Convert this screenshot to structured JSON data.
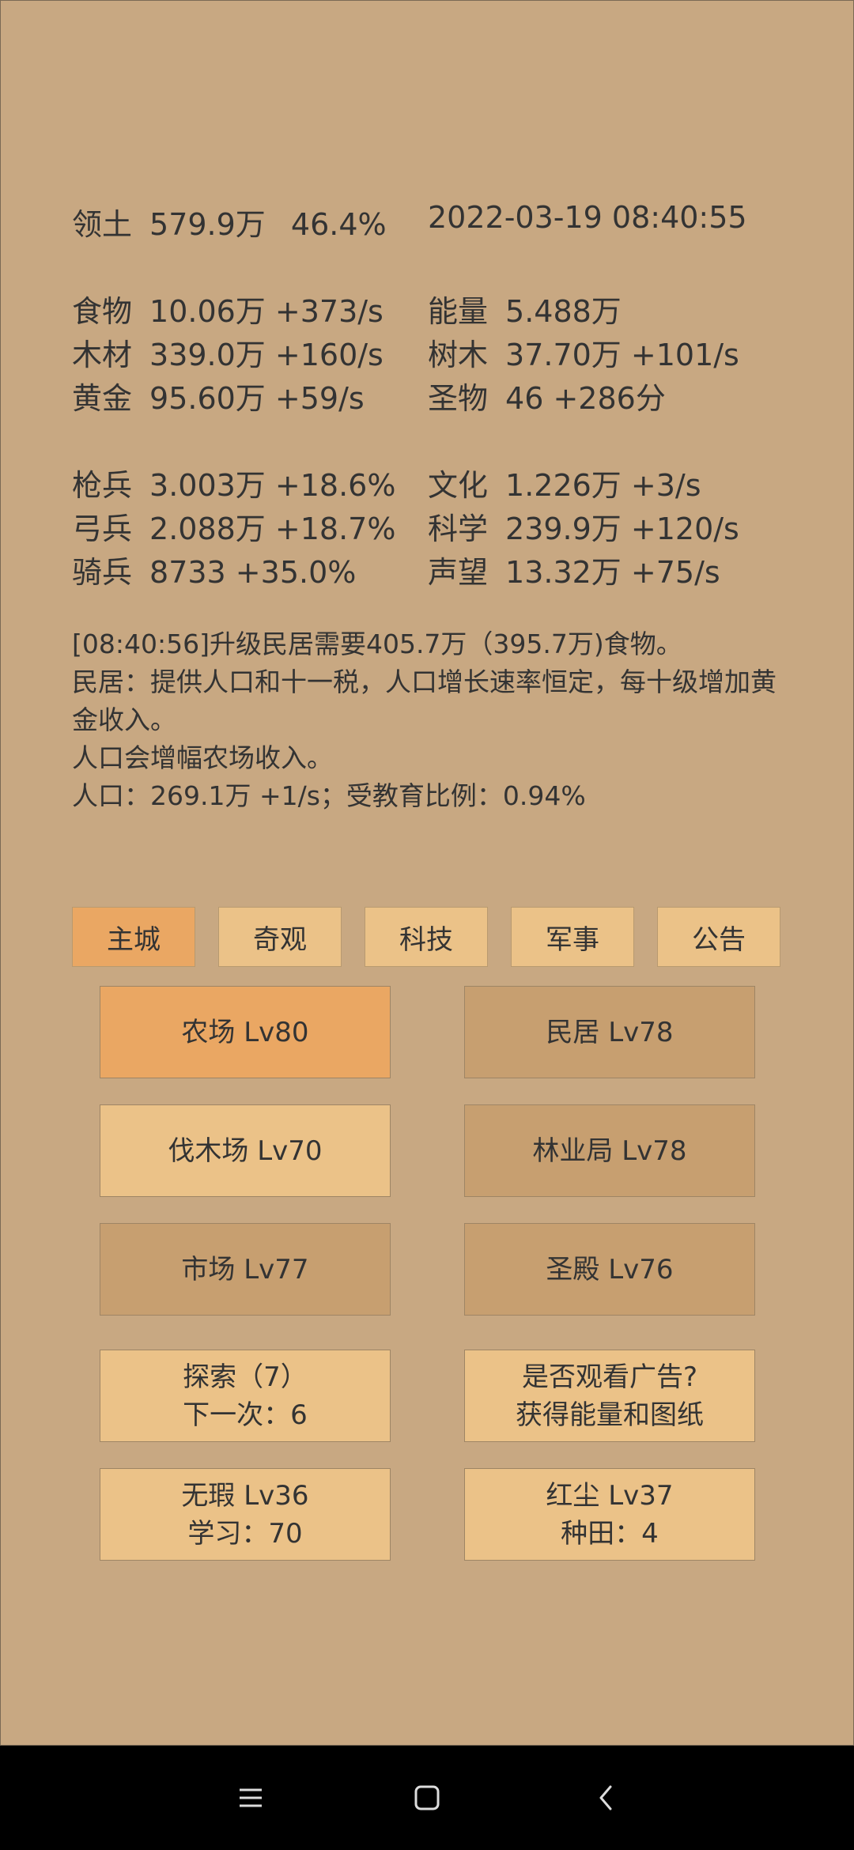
{
  "header": {
    "territory_label": "领土",
    "territory_value": "579.9万",
    "territory_percent": "46.4%",
    "datetime": "2022-03-19 08:40:55"
  },
  "resources_left": [
    {
      "name": "食物",
      "value": "10.06万 +373/s"
    },
    {
      "name": "木材",
      "value": "339.0万 +160/s"
    },
    {
      "name": "黄金",
      "value": "95.60万 +59/s"
    }
  ],
  "resources_right": [
    {
      "name": "能量",
      "value": "5.488万"
    },
    {
      "name": "树木",
      "value": "37.70万 +101/s"
    },
    {
      "name": "圣物",
      "value": "46 +286分"
    }
  ],
  "military_left": [
    {
      "name": "枪兵",
      "value": "3.003万 +18.6%"
    },
    {
      "name": "弓兵",
      "value": "2.088万 +18.7%"
    },
    {
      "name": "骑兵",
      "value": "8733 +35.0%"
    }
  ],
  "military_right": [
    {
      "name": "文化",
      "value": "1.226万 +3/s"
    },
    {
      "name": "科学",
      "value": "239.9万 +120/s"
    },
    {
      "name": "声望",
      "value": "13.32万 +75/s"
    }
  ],
  "log": {
    "line1": "[08:40:56]升级民居需要405.7万（395.7万)食物。",
    "line2": "民居：提供人口和十一税，人口增长速率恒定，每十级增加黄金收入。",
    "line3": "人口会增幅农场收入。",
    "line4": "人口：269.1万 +1/s；受教育比例：0.94%"
  },
  "tabs": {
    "main_city": "主城",
    "wonders": "奇观",
    "tech": "科技",
    "military": "军事",
    "notice": "公告"
  },
  "buildings": {
    "farm": "农场 Lv80",
    "housing": "民居 Lv78",
    "lumber": "伐木场 Lv70",
    "forestry": "林业局 Lv78",
    "market": "市场 Lv77",
    "temple": "圣殿 Lv76"
  },
  "actions": {
    "explore_line1": "探索（7）",
    "explore_line2": "下一次：6",
    "ad_line1": "是否观看广告?",
    "ad_line2": "获得能量和图纸",
    "wuxia_line1": "无瑕 Lv36",
    "wuxia_line2": "学习：70",
    "hongchen_line1": "红尘 Lv37",
    "hongchen_line2": "种田：4"
  },
  "navbar": {
    "menu_icon": "menu-icon",
    "home_icon": "home-icon",
    "back_icon": "back-icon"
  }
}
